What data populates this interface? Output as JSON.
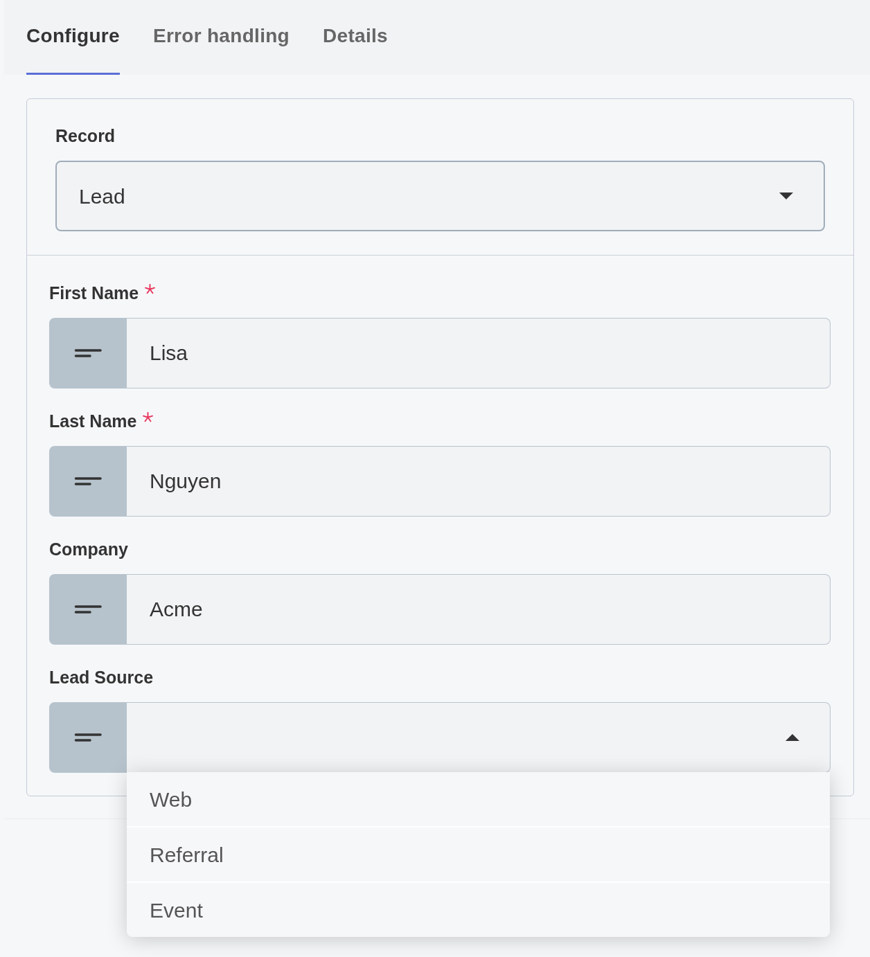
{
  "tabs": [
    {
      "label": "Configure",
      "selected": true
    },
    {
      "label": "Error handling",
      "selected": false
    },
    {
      "label": "Details",
      "selected": false
    }
  ],
  "record": {
    "label": "Record",
    "value": "Lead",
    "expanded": false
  },
  "fields": [
    {
      "kind": "text",
      "label": "First Name",
      "required": true,
      "value": "Lisa"
    },
    {
      "kind": "text",
      "label": "Last Name",
      "required": true,
      "value": "Nguyen"
    },
    {
      "kind": "text",
      "label": "Company",
      "required": false,
      "value": "Acme"
    },
    {
      "kind": "dropdown",
      "label": "Lead Source",
      "required": false,
      "expanded": true,
      "options": [
        {
          "label": "Web",
          "selected": false
        },
        {
          "label": "Referral",
          "selected": false
        },
        {
          "label": "Event",
          "selected": false
        }
      ]
    }
  ]
}
